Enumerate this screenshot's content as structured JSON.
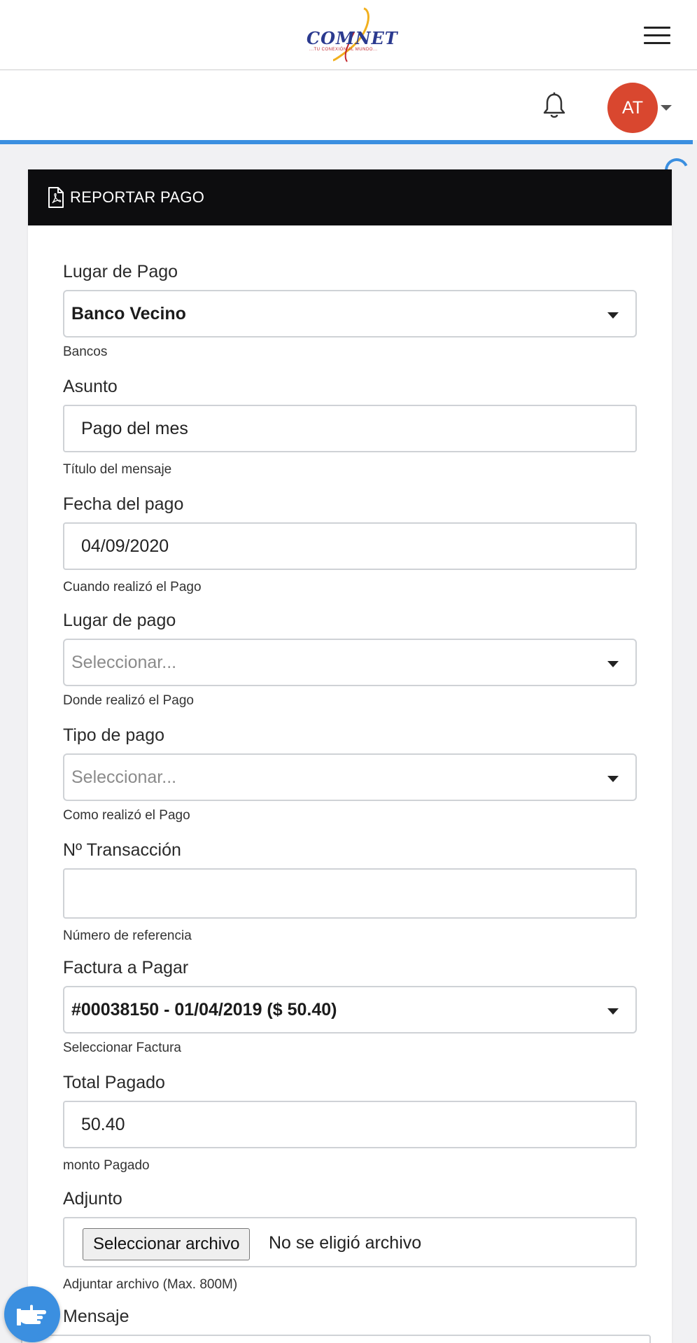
{
  "header": {
    "logo_text": "COMNET",
    "logo_tagline": "...TU CONEXIÓN AL MUNDO...",
    "menu_icon": "hamburger-menu-icon"
  },
  "user": {
    "initials": "AT",
    "avatar_color": "#d9472f",
    "notification_icon": "bell-icon"
  },
  "accent_color": "#3b8fe0",
  "card": {
    "title": "REPORTAR PAGO",
    "title_icon": "pdf-file-icon"
  },
  "form": {
    "lugar_pago": {
      "label": "Lugar de Pago",
      "value": "Banco Vecino",
      "help": "Bancos"
    },
    "asunto": {
      "label": "Asunto",
      "value": "Pago del mes",
      "help": "Título del mensaje"
    },
    "fecha": {
      "label": "Fecha del pago",
      "value": "04/09/2020",
      "help": "Cuando realizó el Pago"
    },
    "lugar_de_pago": {
      "label": "Lugar de pago",
      "placeholder": "Seleccionar...",
      "help": "Donde realizó el Pago"
    },
    "tipo_pago": {
      "label": "Tipo de pago",
      "placeholder": "Seleccionar...",
      "help": "Como realizó el Pago"
    },
    "transaccion": {
      "label": "Nº Transacción",
      "value": "",
      "help": "Número de referencia"
    },
    "factura": {
      "label": "Factura a Pagar",
      "value": "#00038150 - 01/04/2019 ($ 50.40)",
      "help": "Seleccionar Factura"
    },
    "total": {
      "label": "Total Pagado",
      "value": "50.40",
      "help": "monto Pagado"
    },
    "adjunto": {
      "label": "Adjunto",
      "button": "Seleccionar archivo",
      "status": "No se eligió archivo",
      "help": "Adjuntar archivo (Max. 800M)"
    },
    "mensaje": {
      "label": "Mensaje"
    }
  },
  "fab": {
    "icon": "hand-pointer-icon"
  }
}
